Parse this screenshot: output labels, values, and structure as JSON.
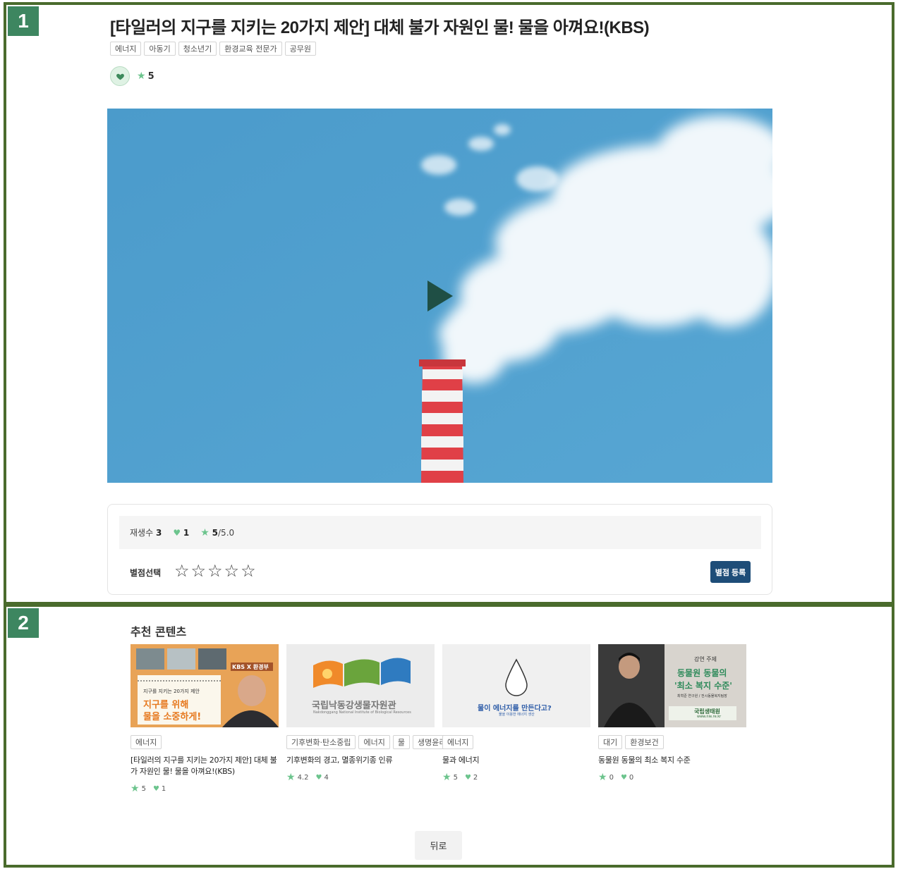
{
  "panels": {
    "one": "1",
    "two": "2"
  },
  "video": {
    "title": "[타일러의 지구를 지키는 20가지 제안] 대체 불가 자원인 물! 물을 아껴요!(KBS)",
    "tags": [
      "에너지",
      "아동기",
      "청소년기",
      "환경교육 전문가",
      "공무원"
    ],
    "rating": "5"
  },
  "stats": {
    "plays_label": "재생수",
    "plays": "3",
    "likes": "1",
    "rating_value": "5",
    "rating_max": "/5.0"
  },
  "rating_form": {
    "label": "별점선택",
    "stars": [
      "☆",
      "☆",
      "☆",
      "☆",
      "☆"
    ],
    "submit_label": "별점 등록"
  },
  "recommend": {
    "heading": "추천 콘텐츠",
    "cards": [
      {
        "tags": [
          "에너지"
        ],
        "title": "[타일러의 지구를 지키는 20가지 제안] 대체 불가 자원인 물! 물을 아껴요!(KBS)",
        "rating": "5",
        "likes": "1",
        "thumb": {
          "badge": "KBS X 환경부",
          "handwriting": "지구를 지키는 20가지 제안",
          "line1": "지구를 위해",
          "line2": "물을 소중하게!"
        }
      },
      {
        "tags": [
          "기후변화·탄소중립",
          "에너지",
          "물",
          "생명윤리"
        ],
        "title": "기후변화의 경고, 멸종위기종 인류",
        "rating": "4.2",
        "likes": "4",
        "thumb": {
          "name": "국립낙동강생물자원관",
          "sub": "Nakdonggang National Institute of Biological Resources"
        }
      },
      {
        "tags": [
          "에너지"
        ],
        "title": "물과 에너지",
        "rating": "5",
        "likes": "2",
        "thumb": {
          "text": "물이 에너지를 만든다고?",
          "sub": "물을 이용한 에너지 생산"
        }
      },
      {
        "tags": [
          "대기",
          "환경보건"
        ],
        "title": "동물원 동물의 최소 복지 수준",
        "rating": "0",
        "likes": "0",
        "thumb": {
          "topic": "강연 주제",
          "line1": "동물원 동물의",
          "line2": "'최소 복지 수준'",
          "speaker": "최혁준 연구원 / 전시동물복지팀장",
          "org": "국립생태원",
          "url": "www.nie.re.kr"
        }
      }
    ]
  },
  "back_label": "뒤로",
  "colors": {
    "frame": "#4a6b2c",
    "badge": "#3d8660",
    "accent_green": "#6cc48d",
    "submit": "#1e4d78",
    "sky": "#4f9fcf"
  },
  "icons": {
    "heart": "heart-icon",
    "star": "star-icon",
    "play": "play-icon"
  }
}
